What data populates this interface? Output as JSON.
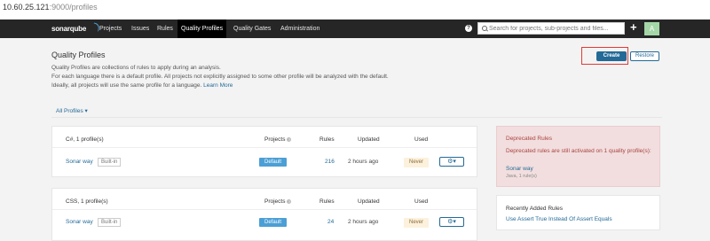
{
  "browser": {
    "url_host": "10.60.25.121",
    "url_path": ":9000/profiles"
  },
  "nav": {
    "logo": "sonarqube",
    "items": [
      {
        "label": "Projects"
      },
      {
        "label": "Issues"
      },
      {
        "label": "Rules"
      },
      {
        "label": "Quality Profiles",
        "active": true
      },
      {
        "label": "Quality Gates"
      },
      {
        "label": "Administration"
      }
    ],
    "help_icon": "?",
    "search_placeholder": "Search for projects, sub-projects and files...",
    "plus": "+",
    "avatar": "A"
  },
  "page": {
    "title": "Quality Profiles",
    "description": [
      "Quality Profiles are collections of rules to apply during an analysis.",
      "For each language there is a default profile. All projects not explicitly assigned to some other profile will be analyzed with the default.",
      "Ideally, all projects will use the same profile for a language."
    ],
    "learn_more": "Learn More",
    "create_label": "Create",
    "restore_label": "Restore",
    "filter_label": "All Profiles ▾"
  },
  "table_headers": {
    "projects": "Projects",
    "rules": "Rules",
    "updated": "Updated",
    "used": "Used"
  },
  "profiles": [
    {
      "language_header": "C#, 1 profile(s)",
      "name": "Sonar way",
      "builtin": "Built-in",
      "default_badge": "Default",
      "rules": "216",
      "updated": "2 hours ago",
      "used": "Never",
      "actions": "⚙▾"
    },
    {
      "language_header": "CSS, 1 profile(s)",
      "name": "Sonar way",
      "builtin": "Built-in",
      "default_badge": "Default",
      "rules": "24",
      "updated": "2 hours ago",
      "used": "Never",
      "actions": "⚙▾"
    }
  ],
  "deprecated": {
    "title": "Deprecated Rules",
    "text": "Deprecated rules are still activated on 1 quality profile(s):",
    "link": "Sonar way",
    "sub": "Java, 1 rule(s)"
  },
  "recent": {
    "title": "Recently Added Rules",
    "link": "Use Assert True Instead Of Assert Equals"
  },
  "colors": {
    "accent": "#236a97",
    "nav_bg": "#262626",
    "highlight": "#e53935"
  }
}
